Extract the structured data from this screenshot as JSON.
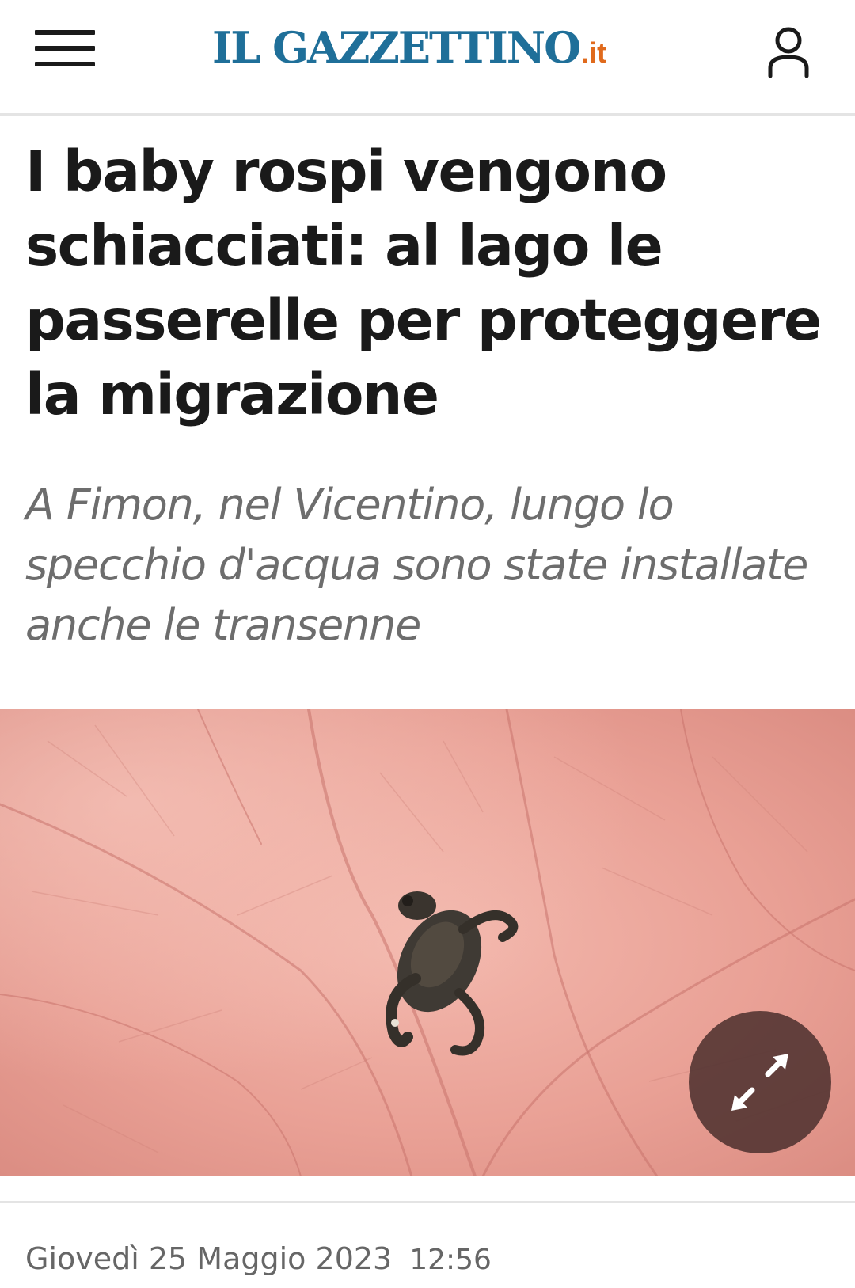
{
  "header": {
    "logo_main": "IL GAZZETTINO",
    "logo_tld": ".it",
    "menu_icon": "hamburger-menu-icon",
    "user_icon": "user-account-icon"
  },
  "article": {
    "title": "I baby rospi vengono schiacciati: al lago le passerelle per proteggere la migrazione",
    "subtitle": "A Fimon, nel Vicentino, lungo lo specchio d'acqua sono state installate anche le transenne",
    "image_icon": "expand-image-icon",
    "date": "Giovedì 25 Maggio 2023",
    "time": "12:56"
  },
  "colors": {
    "logo_blue": "#1f6f99",
    "logo_orange": "#e06a1c",
    "text_dark": "#1a1a1a",
    "text_gray": "#6d6d6d",
    "divider": "#e4e4e4"
  }
}
